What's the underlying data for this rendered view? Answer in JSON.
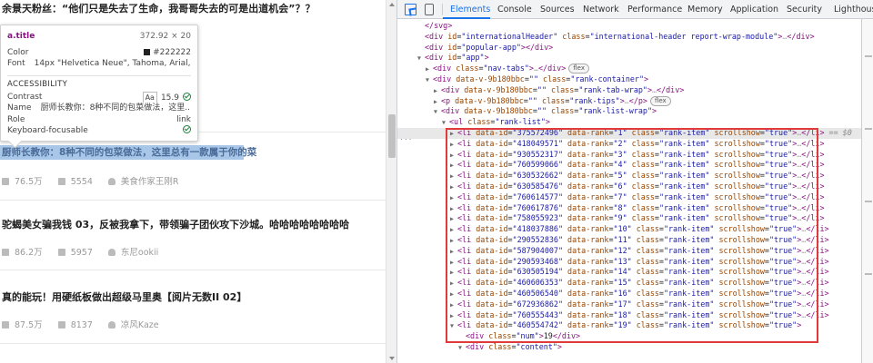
{
  "page": {
    "items": [
      {
        "title": "余景天粉丝：“他们只是失去了生命，我哥哥失去的可是出道机会”？？",
        "views": "",
        "comments": "",
        "author": ""
      },
      {
        "title": "厨师长教你：8种不同的包菜做法，这里总有一款属于你的菜",
        "views": "76.5万",
        "comments": "5554",
        "author": "美食作家王刚R"
      },
      {
        "title": "驼蝎美女骗我钱 03，反被我拿下，带领骗子团伙攻下沙城。哈哈哈哈哈哈哈哈",
        "views": "86.2万",
        "comments": "5957",
        "author": "东尼ookii"
      },
      {
        "title": "真的能玩！用硬纸板做出超级马里奥【阅片无数II 02】",
        "views": "87.5万",
        "comments": "8137",
        "author": "凉风Kaze"
      }
    ],
    "highlight_text": "厨师长教你：8种不同的包菜做法，这里总有一款属于你的菜"
  },
  "tooltip": {
    "selector": "a.title",
    "size": "372.92 × 20",
    "color_label": "Color",
    "color_value": "#222222",
    "font_label": "Font",
    "font_value": "14px \"Helvetica Neue\", Tahoma, Arial, Pin...",
    "section": "ACCESSIBILITY",
    "contrast_label": "Contrast",
    "contrast_value": "15.9",
    "contrast_aa": "Aa",
    "name_label": "Name",
    "name_value": "厨师长教你：8种不同的包菜做法，这里...",
    "role_label": "Role",
    "role_value": "link",
    "kbd_label": "Keyboard-focusable"
  },
  "devtools": {
    "tabs": [
      "Elements",
      "Console",
      "Sources",
      "Network",
      "Performance",
      "Memory",
      "Application",
      "Security",
      "Lighthouse"
    ],
    "active_tab": "Elements",
    "selected_marker": "== $0",
    "dots": "...",
    "lines": [
      {
        "t": "close",
        "tag": "svg",
        "indent": 0,
        "tri": ""
      },
      {
        "t": "el",
        "indent": 0,
        "tri": "",
        "tag": "div",
        "attrs": [
          [
            "id",
            "internationalHeader"
          ],
          [
            "class",
            "international-header report-wrap-module"
          ]
        ],
        "collapsed": true
      },
      {
        "t": "el",
        "indent": 0,
        "tri": "",
        "tag": "div",
        "attrs": [
          [
            "id",
            "popular-app"
          ]
        ],
        "empty": true
      },
      {
        "t": "open",
        "indent": 0,
        "tri": "▼",
        "tag": "div",
        "attrs": [
          [
            "id",
            "app"
          ]
        ]
      },
      {
        "t": "el",
        "indent": 1,
        "tri": "▶",
        "tag": "div",
        "attrs": [
          [
            "class",
            "nav-tabs"
          ]
        ],
        "collapsed": true,
        "badge": "flex"
      },
      {
        "t": "open",
        "indent": 1,
        "tri": "▼",
        "tag": "div",
        "attrs": [
          [
            "data-v-9b180bbc",
            ""
          ],
          [
            "class",
            "rank-container"
          ]
        ]
      },
      {
        "t": "el",
        "indent": 2,
        "tri": "▶",
        "tag": "div",
        "attrs": [
          [
            "data-v-9b180bbc",
            ""
          ],
          [
            "class",
            "rank-tab-wrap"
          ]
        ],
        "collapsed": true
      },
      {
        "t": "el",
        "indent": 2,
        "tri": "▶",
        "tag": "p",
        "attrs": [
          [
            "data-v-9b180bbc",
            ""
          ],
          [
            "class",
            "rank-tips"
          ]
        ],
        "collapsed": true,
        "badge": "flex"
      },
      {
        "t": "open",
        "indent": 2,
        "tri": "▼",
        "tag": "div",
        "attrs": [
          [
            "data-v-9b180bbc",
            ""
          ],
          [
            "class",
            "rank-list-wrap"
          ]
        ]
      },
      {
        "t": "open",
        "indent": 3,
        "tri": "▼",
        "tag": "ul",
        "attrs": [
          [
            "class",
            "rank-list"
          ]
        ]
      },
      {
        "t": "li",
        "indent": 4,
        "id": "375572496",
        "rank": "1",
        "sel": true
      },
      {
        "t": "li",
        "indent": 4,
        "id": "418049571",
        "rank": "2"
      },
      {
        "t": "li",
        "indent": 4,
        "id": "930552317",
        "rank": "3"
      },
      {
        "t": "li",
        "indent": 4,
        "id": "760599066",
        "rank": "4"
      },
      {
        "t": "li",
        "indent": 4,
        "id": "630532662",
        "rank": "5"
      },
      {
        "t": "li",
        "indent": 4,
        "id": "630585476",
        "rank": "6"
      },
      {
        "t": "li",
        "indent": 4,
        "id": "760614577",
        "rank": "7"
      },
      {
        "t": "li",
        "indent": 4,
        "id": "760617876",
        "rank": "8"
      },
      {
        "t": "li",
        "indent": 4,
        "id": "758055923",
        "rank": "9"
      },
      {
        "t": "li",
        "indent": 4,
        "id": "418037886",
        "rank": "10"
      },
      {
        "t": "li",
        "indent": 4,
        "id": "290552836",
        "rank": "11"
      },
      {
        "t": "li",
        "indent": 4,
        "id": "587904007",
        "rank": "12"
      },
      {
        "t": "li",
        "indent": 4,
        "id": "290593468",
        "rank": "13"
      },
      {
        "t": "li",
        "indent": 4,
        "id": "630505194",
        "rank": "14"
      },
      {
        "t": "li",
        "indent": 4,
        "id": "460606353",
        "rank": "15"
      },
      {
        "t": "li",
        "indent": 4,
        "id": "460506540",
        "rank": "16"
      },
      {
        "t": "li",
        "indent": 4,
        "id": "672936862",
        "rank": "17"
      },
      {
        "t": "li",
        "indent": 4,
        "id": "760555443",
        "rank": "18"
      },
      {
        "t": "liopen",
        "indent": 4,
        "id": "460554742",
        "rank": "19"
      },
      {
        "t": "text",
        "indent": 5,
        "tri": "",
        "tag": "div",
        "attrs": [
          [
            "class",
            "num"
          ]
        ],
        "text": "19"
      },
      {
        "t": "open",
        "indent": 5,
        "tri": "▼",
        "tag": "div",
        "attrs": [
          [
            "class",
            "content"
          ]
        ]
      }
    ],
    "li_class": "rank-item",
    "li_scrollshow": "true"
  }
}
